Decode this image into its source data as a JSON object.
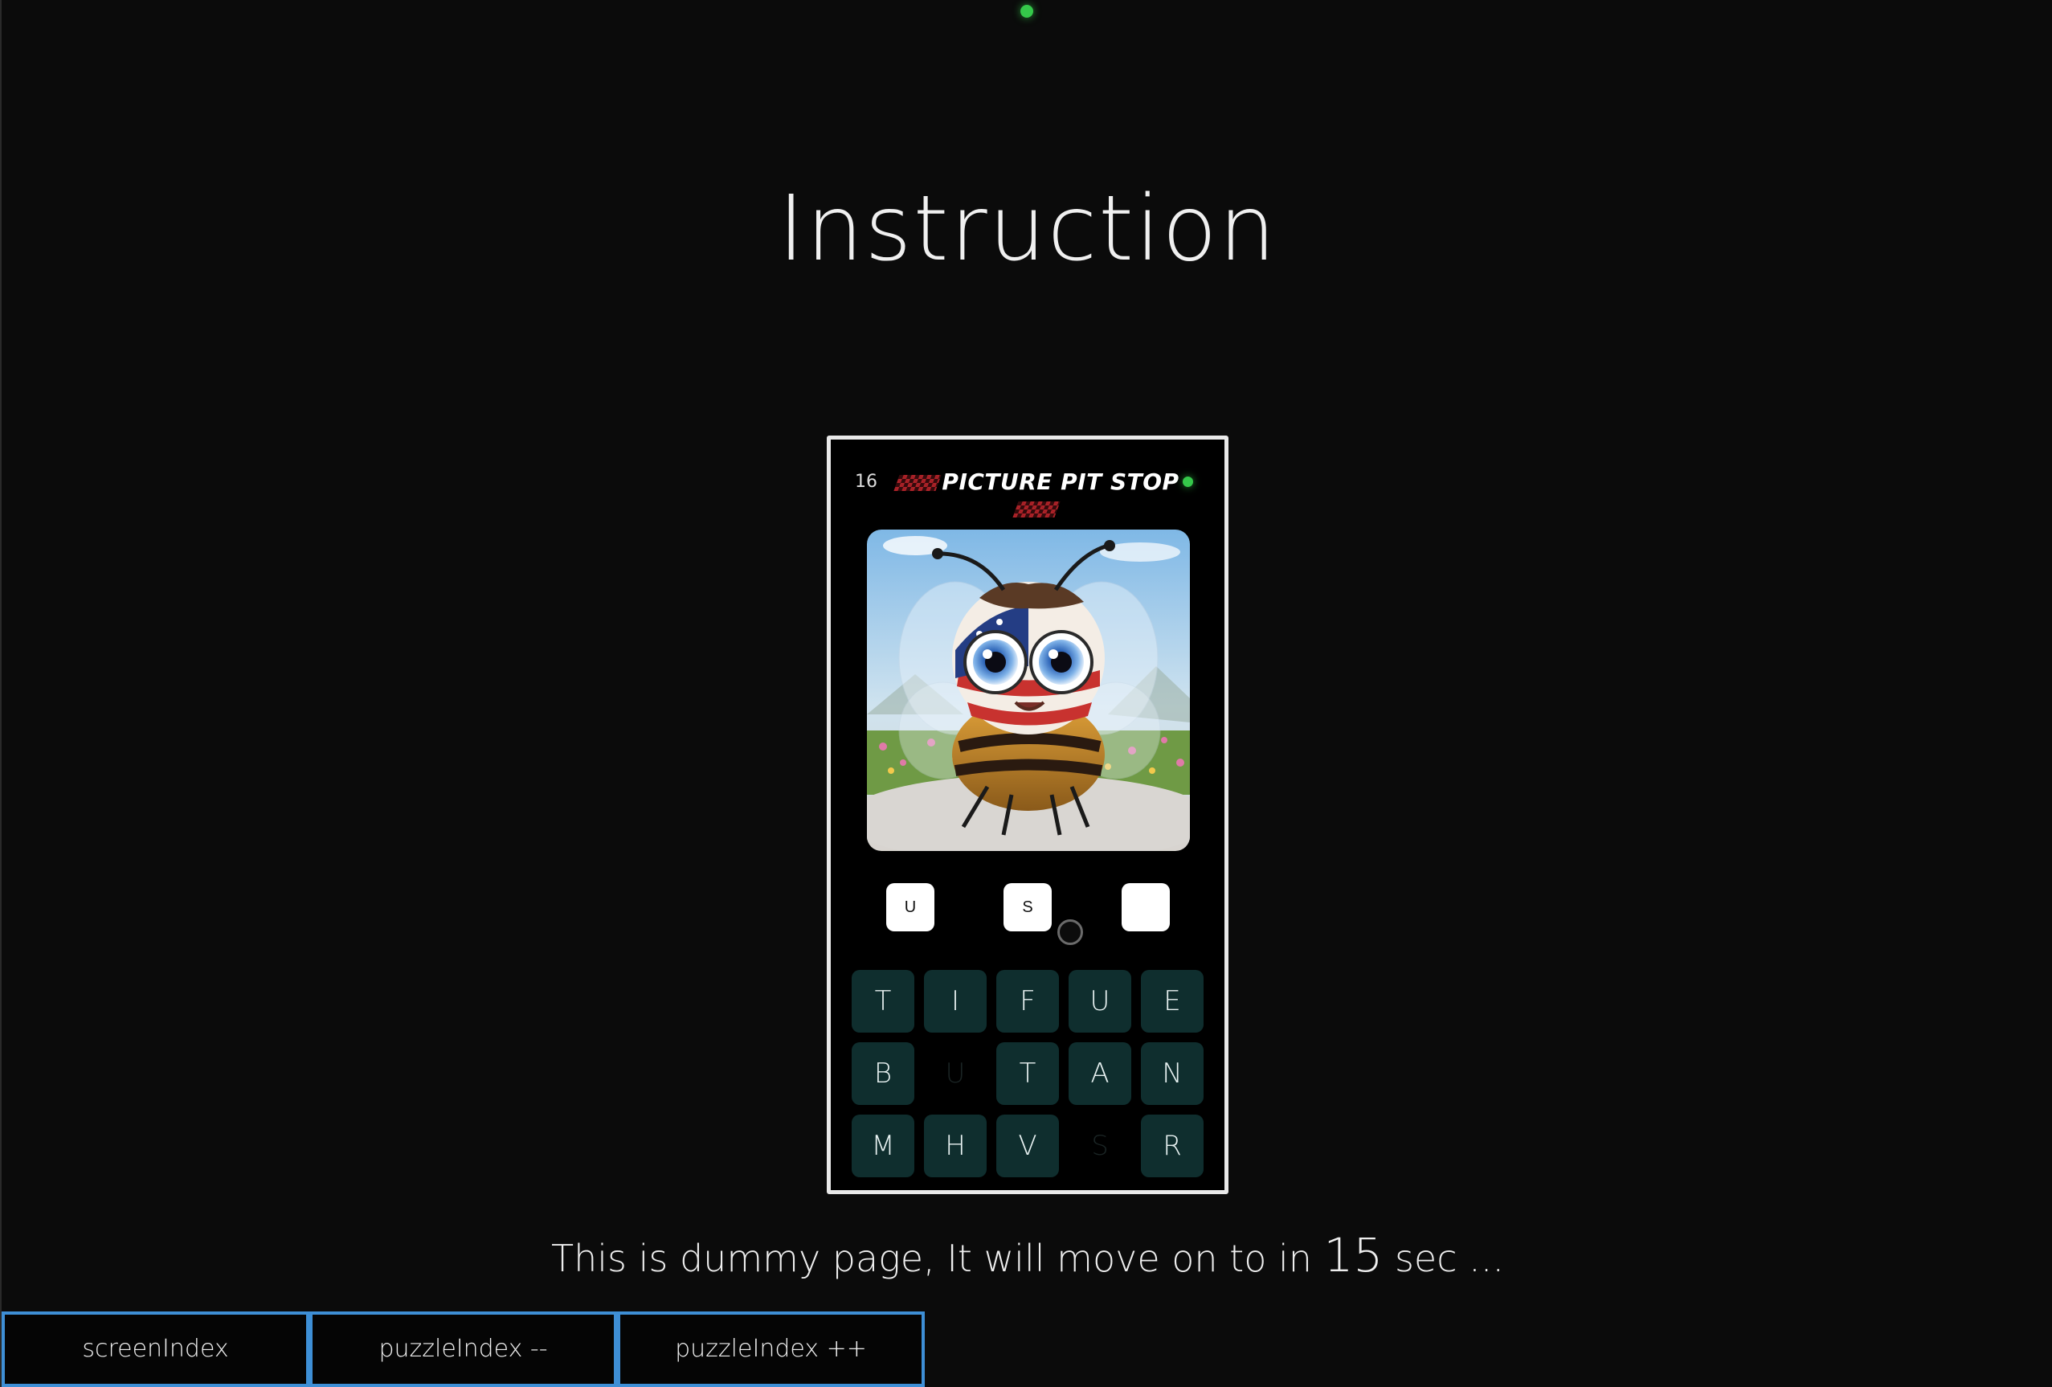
{
  "page": {
    "title": "Instruction",
    "countdown": {
      "prefix": "This is dummy page, It will move on to in ",
      "seconds": "15",
      "suffix": " sec ..."
    }
  },
  "game": {
    "level": "16",
    "title": "PICTURE PIT STOP",
    "image_icon": "patriotic-bee-illustration",
    "answer_slots": [
      "U",
      "S",
      ""
    ],
    "keyboard": [
      {
        "letter": "T",
        "used": false
      },
      {
        "letter": "I",
        "used": false
      },
      {
        "letter": "F",
        "used": false
      },
      {
        "letter": "U",
        "used": false
      },
      {
        "letter": "E",
        "used": false
      },
      {
        "letter": "B",
        "used": false
      },
      {
        "letter": "U",
        "used": true
      },
      {
        "letter": "T",
        "used": false
      },
      {
        "letter": "A",
        "used": false
      },
      {
        "letter": "N",
        "used": false
      },
      {
        "letter": "M",
        "used": false
      },
      {
        "letter": "H",
        "used": false
      },
      {
        "letter": "V",
        "used": false
      },
      {
        "letter": "S",
        "used": true
      },
      {
        "letter": "R",
        "used": false
      }
    ]
  },
  "debug_buttons": {
    "screen_index": "screenIndex",
    "puzzle_prev": "puzzleIndex --",
    "puzzle_next": "puzzleIndex ++"
  },
  "colors": {
    "background": "#0b0b0b",
    "status_dot": "#35c84a",
    "key_bg": "#0f2e2e",
    "debug_border": "#3e8fd6"
  }
}
